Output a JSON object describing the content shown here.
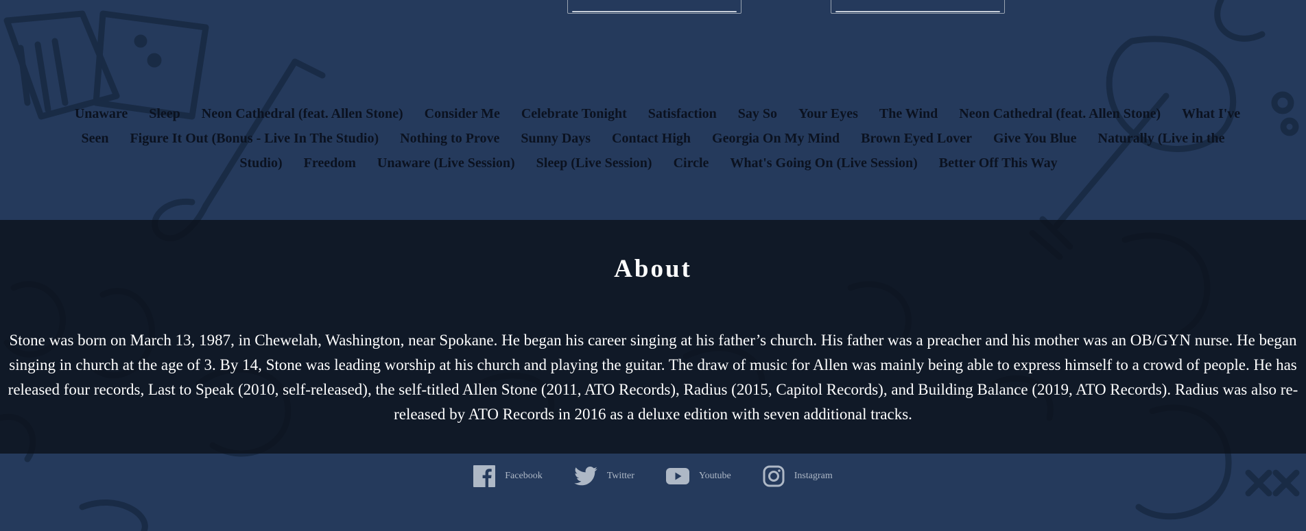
{
  "tracklist": [
    "Unaware",
    "Sleep",
    "Neon Cathedral (feat. Allen Stone)",
    "Consider Me",
    "Celebrate Tonight",
    "Satisfaction",
    "Say So",
    "Your Eyes",
    "The Wind",
    "Neon Cathedral (feat. Allen Stone)",
    "What I've Seen",
    "Figure It Out (Bonus - Live In The Studio)",
    "Nothing to Prove",
    "Sunny Days",
    "Contact High",
    "Georgia On My Mind",
    "Brown Eyed Lover",
    "Give You Blue",
    "Naturally (Live in the Studio)",
    "Freedom",
    "Unaware (Live Session)",
    "Sleep (Live Session)",
    "Circle",
    "What's Going On (Live Session)",
    "Better Off This Way"
  ],
  "about": {
    "heading": "About",
    "text": "Stone was born on March 13, 1987, in Chewelah, Washington, near Spokane. He began his career singing at his father’s church. His father was a preacher and his mother was an OB/GYN nurse. He began singing in church at the age of 3. By 14, Stone was leading worship at his church and playing the guitar. The draw of music for Allen was mainly being able to express himself to a crowd of people. He has released four records, Last to Speak (2010, self-released), the self-titled Allen Stone (2011, ATO Records), Radius (2015, Capitol Records), and Building Balance (2019, ATO Records). Radius was also re-released by ATO Records in 2016 as a deluxe edition with seven additional tracks."
  },
  "social": {
    "facebook": {
      "label": "Facebook",
      "icon": "facebook-icon"
    },
    "twitter": {
      "label": "Twitter",
      "icon": "twitter-icon"
    },
    "youtube": {
      "label": "Youtube",
      "icon": "youtube-icon"
    },
    "instagram": {
      "label": "Instagram",
      "icon": "instagram-icon"
    }
  },
  "colors": {
    "background": "#253a5c",
    "about_band": "#111a26",
    "track_text": "#0b1220",
    "social_text": "#aeb8c6"
  }
}
